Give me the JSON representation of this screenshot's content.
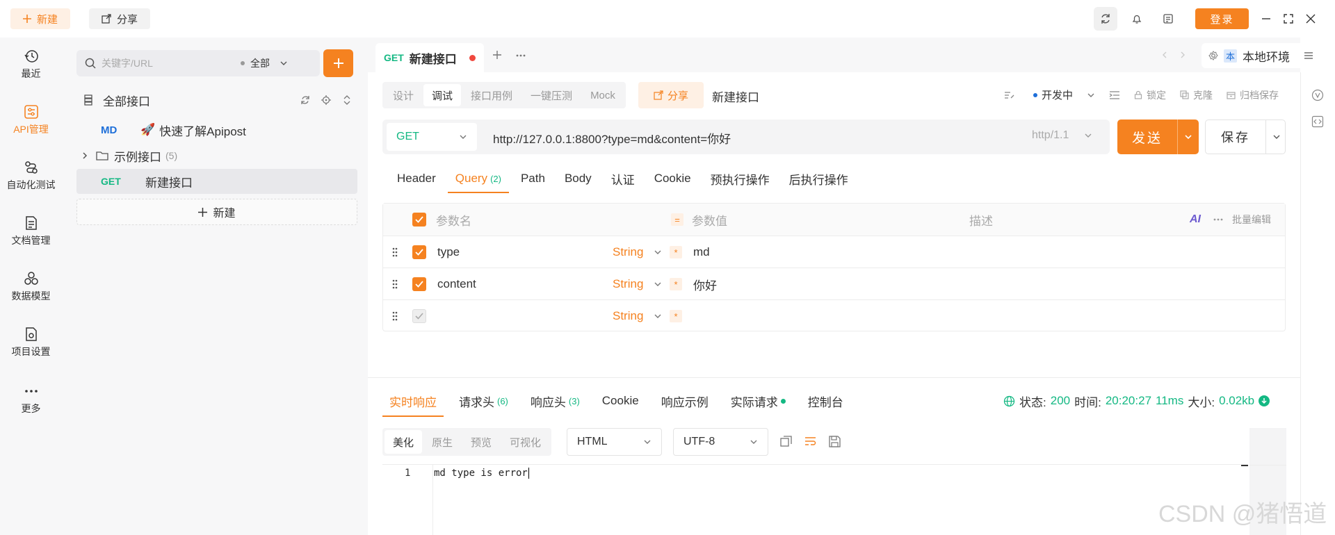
{
  "topbar": {
    "new_label": "新建",
    "share_label": "分享",
    "login_label": "登录"
  },
  "rail": [
    {
      "label": "最近",
      "icon": "history-icon"
    },
    {
      "label": "API管理",
      "icon": "api-icon",
      "active": true
    },
    {
      "label": "自动化测试",
      "icon": "automation-icon"
    },
    {
      "label": "文档管理",
      "icon": "document-icon"
    },
    {
      "label": "数据模型",
      "icon": "data-model-icon"
    },
    {
      "label": "项目设置",
      "icon": "project-settings-icon"
    },
    {
      "label": "更多",
      "icon": "more-icon"
    }
  ],
  "sidebar": {
    "search_placeholder": "关键字/URL",
    "filter_label": "全部",
    "all_apis": "全部接口",
    "items": [
      {
        "tag": "MD",
        "label": "快速了解Apipost"
      },
      {
        "label": "示例接口",
        "count": "(5)"
      },
      {
        "tag": "GET",
        "label": "新建接口"
      }
    ],
    "new_label": "新建"
  },
  "tabs": {
    "active_method": "GET",
    "active_title": "新建接口",
    "env_tag": "本",
    "env_label": "本地环境"
  },
  "subtabs": [
    "设计",
    "调试",
    "接口用例",
    "一键压测",
    "Mock"
  ],
  "share_label": "分享",
  "api_name": "新建接口",
  "toolbar": {
    "status": "开发中",
    "lock": "锁定",
    "clone": "克隆",
    "archive": "归档保存"
  },
  "request": {
    "method": "GET",
    "url": "http://127.0.0.1:8800?type=md&content=你好",
    "protocol": "http/1.1",
    "send_label": "发送",
    "save_label": "保存"
  },
  "request_tabs": [
    {
      "label": "Header"
    },
    {
      "label": "Query",
      "count": "(2)"
    },
    {
      "label": "Path"
    },
    {
      "label": "Body"
    },
    {
      "label": "认证"
    },
    {
      "label": "Cookie"
    },
    {
      "label": "预执行操作"
    },
    {
      "label": "后执行操作"
    }
  ],
  "params": {
    "col_name": "参数名",
    "col_value": "参数值",
    "col_desc": "描述",
    "ai_label": "AI",
    "bulk_label": "批量编辑",
    "rows": [
      {
        "name": "type",
        "type": "String",
        "value": "md"
      },
      {
        "name": "content",
        "type": "String",
        "value": "你好"
      },
      {
        "name": "",
        "type": "String",
        "value": ""
      }
    ]
  },
  "response_tabs": [
    {
      "label": "实时响应"
    },
    {
      "label": "请求头",
      "count": "(6)"
    },
    {
      "label": "响应头",
      "count": "(3)"
    },
    {
      "label": "Cookie"
    },
    {
      "label": "响应示例"
    },
    {
      "label": "实际请求"
    },
    {
      "label": "控制台"
    }
  ],
  "status": {
    "status_label": "状态:",
    "code": "200",
    "time_label": "时间:",
    "time": "20:20:27",
    "duration": "11ms",
    "size_label": "大小:",
    "size": "0.02kb"
  },
  "view_tabs": [
    "美化",
    "原生",
    "预览",
    "可视化"
  ],
  "format": "HTML",
  "encoding": "UTF-8",
  "editor": {
    "line_no": "1",
    "content": "md type is error"
  },
  "watermark": "CSDN @猪悟道",
  "colors": {
    "accent": "#f58220",
    "get": "#14b883",
    "md": "#1e6fd9"
  }
}
